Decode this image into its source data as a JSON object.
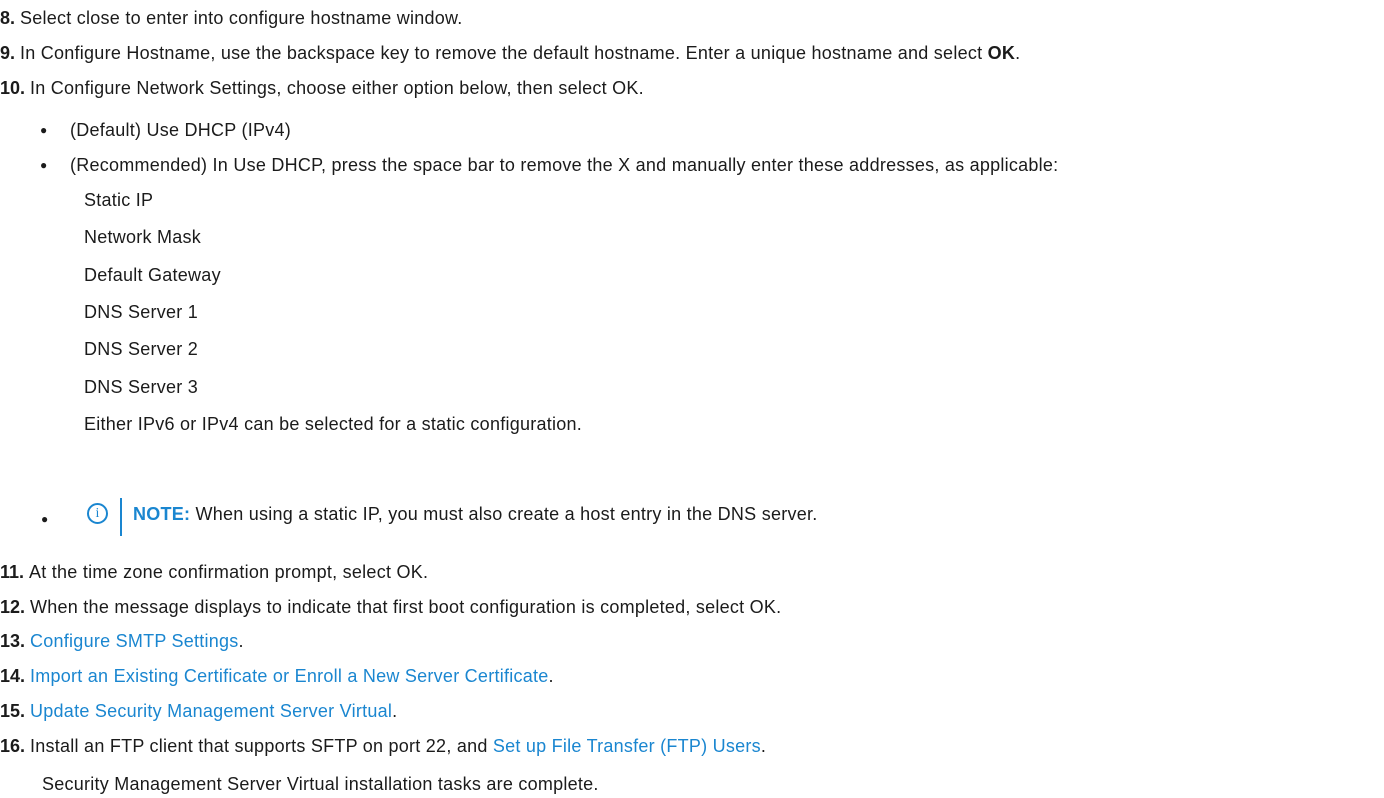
{
  "steps": [
    {
      "num": "8.",
      "text": "Select close to enter into configure hostname window."
    },
    {
      "num": "9.",
      "text_a": "In Configure Hostname, use the backspace key to remove the default hostname. Enter a unique hostname and select ",
      "bold": "OK",
      "text_b": "."
    },
    {
      "num": "10.",
      "text": "In Configure Network Settings, choose either option below, then select OK."
    },
    {
      "num": "11.",
      "text": "At the time zone confirmation prompt, select OK."
    },
    {
      "num": "12.",
      "text": "When the message displays to indicate that first boot configuration is completed, select OK."
    },
    {
      "num": "13.",
      "link": "Configure SMTP Settings",
      "after": "."
    },
    {
      "num": "14.",
      "link": "Import an Existing Certificate or Enroll a New Server Certificate",
      "after": "."
    },
    {
      "num": "15.",
      "link": "Update Security Management Server Virtual",
      "after": "."
    },
    {
      "num": "16.",
      "text": "Install an FTP client that supports SFTP on port 22, and ",
      "link": "Set up File Transfer (FTP) Users",
      "after": "."
    }
  ],
  "bullets": [
    "(Default) Use DHCP (IPv4)",
    "(Recommended) In Use DHCP, press the space bar to remove the X and manually enter these addresses, as applicable:"
  ],
  "addresses": [
    "Static IP",
    "Network Mask",
    "Default Gateway",
    "DNS Server 1",
    "DNS Server 2",
    "DNS Server 3"
  ],
  "static_note": "Either IPv6 or IPv4 can be selected for a static configuration.",
  "note": {
    "label": "NOTE:",
    "text": " When using a static IP, you must also create a host entry in the DNS server.",
    "icon": "info-icon"
  },
  "conclusion": "Security Management Server Virtual installation tasks are complete.",
  "colors": {
    "link": "#1a86d0",
    "text": "#1b1b1b"
  }
}
